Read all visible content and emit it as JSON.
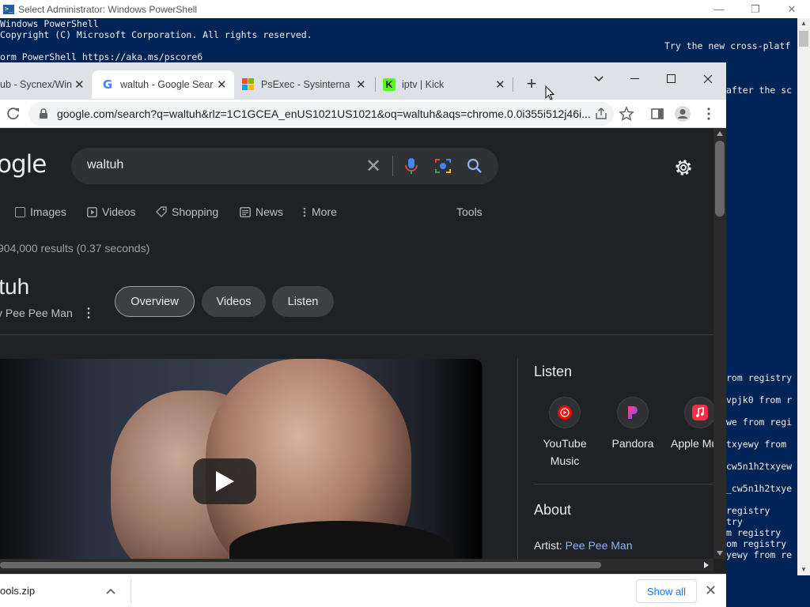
{
  "powershell": {
    "title": "Select Administrator: Windows PowerShell",
    "window_controls": {
      "minimize": "—",
      "maximize": "❐",
      "close": "✕"
    },
    "console_lines": [
      "Windows PowerShell",
      "Copyright (C) Microsoft Corporation. All rights reserved.",
      "orm PowerShell https://aka.ms/pscore6"
    ],
    "right_fragments": [
      "Try the new cross-platf",
      "after the sc",
      "rom registry",
      "vpjk0 from r",
      "we from regi",
      "txyewy from",
      "cw5n1h2txyew",
      "_cw5n1h2txye",
      "registry",
      "try",
      "m registry",
      "om registry",
      "yewy from re"
    ]
  },
  "chrome": {
    "tabs": [
      {
        "label": "ub - Sycnex/Win",
        "favicon": "github-icon",
        "active": false
      },
      {
        "label": "waltuh - Google Sear",
        "favicon": "google-icon",
        "active": true
      },
      {
        "label": "PsExec - Sysinternals",
        "favicon": "microsoft-icon",
        "active": false
      },
      {
        "label": "iptv | Kick",
        "favicon": "kick-icon",
        "active": false
      }
    ],
    "tab_close": "✕",
    "new_tab": "+",
    "url": "google.com/search?q=waltuh&rlz=1C1GCEA_enUS1021US1021&oq=waltuh&aqs=chrome.0.0i355i512j46i..."
  },
  "google": {
    "logo_partial": "ogle",
    "query": "waltuh",
    "clear_glyph": "✕",
    "filters": [
      "Images",
      "Videos",
      "Shopping",
      "News",
      "More",
      "Tools"
    ],
    "result_stats": "904,000 results (0.37 seconds)",
    "entity": {
      "title": "ltuh",
      "subtitle": "y Pee Pee Man",
      "more_glyph": "⋮",
      "tabs": [
        "Overview",
        "Videos",
        "Listen"
      ]
    },
    "listen": {
      "title": "Listen",
      "platforms": [
        {
          "name_line1": "YouTube",
          "name_line2": "Music",
          "icon": "youtube-music-icon",
          "color": "#ff0000"
        },
        {
          "name_line1": "Pandora",
          "name_line2": "",
          "icon": "pandora-icon",
          "color": "#e040fb"
        },
        {
          "name_line1": "Apple Mu",
          "name_line2": "",
          "icon": "apple-music-icon",
          "color": "#fa2d48"
        }
      ]
    },
    "about": {
      "title": "About",
      "artist_label": "Artist:",
      "artist_value": "Pee Pee Man"
    }
  },
  "downloads": {
    "file": "ools.zip",
    "chevron": "^",
    "show_all": "Show all",
    "close": "✕"
  },
  "colors": {
    "powershell_bg": "#012456",
    "chrome_dark": "#202124",
    "link_blue": "#8ab4f8"
  }
}
